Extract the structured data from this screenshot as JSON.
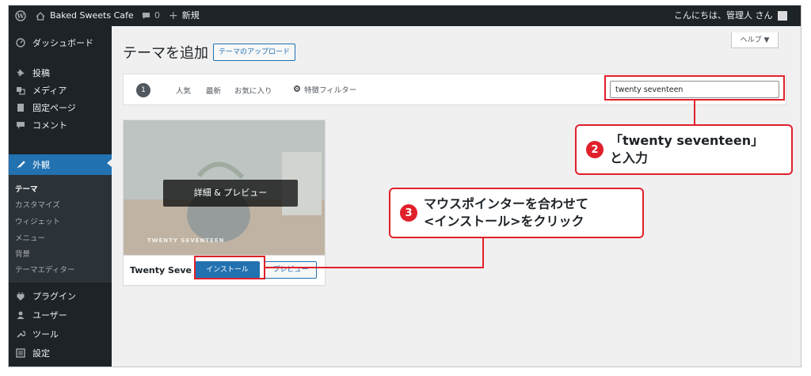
{
  "admin_bar": {
    "site_name": "Baked Sweets Cafe",
    "comment_count": "0",
    "new_label": "新規",
    "greeting": "こんにちは、管理人 さん"
  },
  "sidebar": {
    "items": [
      {
        "label": "ダッシュボード",
        "icon": "dashboard-icon"
      },
      {
        "label": "投稿",
        "icon": "pin-icon"
      },
      {
        "label": "メディア",
        "icon": "media-icon"
      },
      {
        "label": "固定ページ",
        "icon": "page-icon"
      },
      {
        "label": "コメント",
        "icon": "comment-icon"
      },
      {
        "label": "外観",
        "icon": "brush-icon"
      },
      {
        "label": "プラグイン",
        "icon": "plugin-icon"
      },
      {
        "label": "ユーザー",
        "icon": "user-icon"
      },
      {
        "label": "ツール",
        "icon": "wrench-icon"
      },
      {
        "label": "設定",
        "icon": "settings-icon"
      }
    ],
    "submenu": [
      "テーマ",
      "カスタマイズ",
      "ウィジェット",
      "メニュー",
      "背景",
      "テーマエディター"
    ]
  },
  "main": {
    "title": "テーマを追加",
    "upload_button": "テーマのアップロード",
    "help_button": "ヘルプ ▼",
    "filter": {
      "count": "1",
      "links": [
        "人気",
        "最新",
        "お気に入り"
      ],
      "feature_filter": "特徴フィルター",
      "search_value": "twenty seventeen"
    },
    "theme_card": {
      "name": "Twenty Seve",
      "details_button": "詳細 & プレビュー",
      "install_button": "インストール",
      "preview_button": "プレビュー",
      "screenshot_brand": "TWENTY SEVENTEEN"
    }
  },
  "annotations": {
    "step2": {
      "number": "2",
      "line1": "「twenty seventeen」",
      "line2": "と入力"
    },
    "step3": {
      "number": "3",
      "line1": "マウスポインターを合わせて",
      "line2": "<インストール>をクリック"
    },
    "color": "#e0202b"
  },
  "colors": {
    "admin_bar": "#1d2327",
    "accent": "#2271b1",
    "content_bg": "#f0f0f1"
  }
}
